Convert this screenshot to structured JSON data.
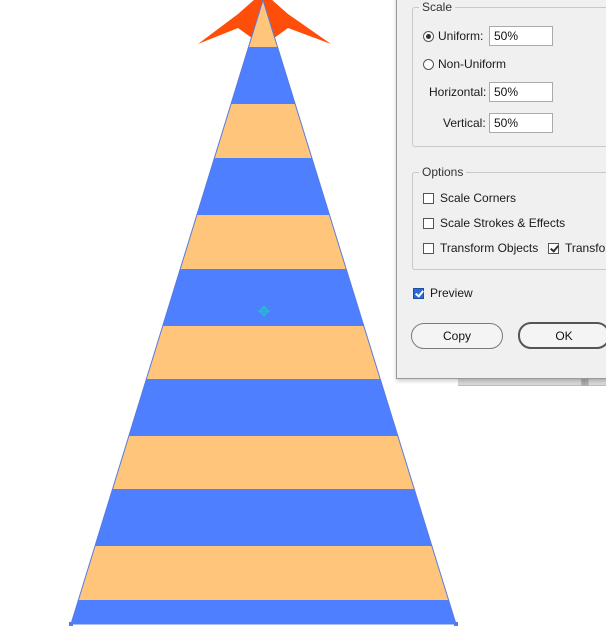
{
  "artwork": {
    "stripe_colors": [
      "#ffc57a",
      "#4d7fff"
    ],
    "star_color": "#ff4d0a",
    "outline_color": "#5a7be0",
    "center_marker_color": "#1fc7c7"
  },
  "dialog": {
    "scale_group": {
      "legend": "Scale",
      "uniform_label": "Uniform:",
      "uniform_value": "50%",
      "uniform_selected": true,
      "nonuniform_label": "Non-Uniform",
      "horizontal_label": "Horizontal:",
      "horizontal_value": "50%",
      "vertical_label": "Vertical:",
      "vertical_value": "50%"
    },
    "options_group": {
      "legend": "Options",
      "scale_corners_label": "Scale Corners",
      "scale_corners_checked": false,
      "scale_strokes_label": "Scale Strokes & Effects",
      "scale_strokes_checked": false,
      "transform_objects_label": "Transform Objects",
      "transform_objects_checked": false,
      "transform_patterns_label": "Transfor",
      "transform_patterns_checked": true
    },
    "preview_label": "Preview",
    "preview_checked": true,
    "copy_label": "Copy",
    "ok_label": "OK"
  }
}
